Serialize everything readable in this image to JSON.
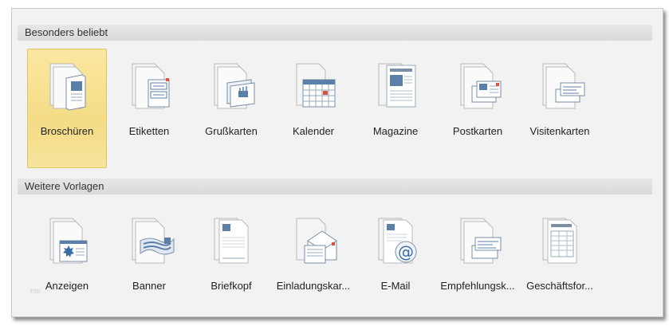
{
  "sections": [
    {
      "title": "Besonders beliebt",
      "items": [
        {
          "label": "Broschüren",
          "icon": "brochure-icon",
          "selected": true
        },
        {
          "label": "Etiketten",
          "icon": "labels-icon",
          "selected": false
        },
        {
          "label": "Grußkarten",
          "icon": "greeting-card-icon",
          "selected": false
        },
        {
          "label": "Kalender",
          "icon": "calendar-icon",
          "selected": false
        },
        {
          "label": "Magazine",
          "icon": "magazine-icon",
          "selected": false
        },
        {
          "label": "Postkarten",
          "icon": "postcard-icon",
          "selected": false
        },
        {
          "label": "Visitenkarten",
          "icon": "business-card-icon",
          "selected": false
        }
      ]
    },
    {
      "title": "Weitere Vorlagen",
      "items": [
        {
          "label": "Anzeigen",
          "icon": "advertisement-icon",
          "selected": false
        },
        {
          "label": "Banner",
          "icon": "banner-icon",
          "selected": false
        },
        {
          "label": "Briefkopf",
          "icon": "letterhead-icon",
          "selected": false
        },
        {
          "label": "Einladungskar...",
          "icon": "invitation-card-icon",
          "selected": false
        },
        {
          "label": "E-Mail",
          "icon": "email-icon",
          "selected": false
        },
        {
          "label": "Empfehlungsk...",
          "icon": "referral-card-icon",
          "selected": false
        },
        {
          "label": "Geschäftsfor...",
          "icon": "business-form-icon",
          "selected": false
        }
      ]
    }
  ],
  "watermark": "hto",
  "colors": {
    "selected_fill": "#f4dc86",
    "selected_border": "#e2c364",
    "icon_accent": "#3a6ea5",
    "calendar_mark": "#e05040"
  }
}
